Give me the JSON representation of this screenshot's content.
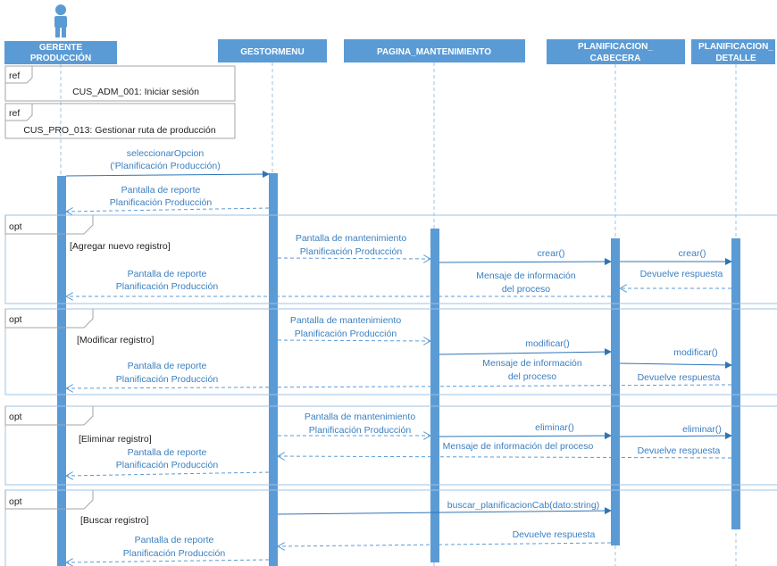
{
  "actor": {
    "icon": "user-icon",
    "label_line1": "GERENTE",
    "label_line2": "PRODUCCIÓN"
  },
  "lifelines": {
    "gestormenu": "GESTORMENU",
    "pagina": "PAGINA_MANTENIMIENTO",
    "cabecera_line1": "PLANIFICACION_",
    "cabecera_line2": "CABECERA",
    "detalle_line1": "PLANIFICACION_",
    "detalle_line2": "DETALLE"
  },
  "refs": [
    {
      "tag": "ref",
      "text": "CUS_ADM_001: Iniciar sesión"
    },
    {
      "tag": "ref",
      "text": "CUS_PRO_013: Gestionar ruta de producción"
    }
  ],
  "initial": {
    "call_line1": "seleccionarOpcion",
    "call_line2": "('Planificación Producción)",
    "return_line1": "Pantalla de reporte",
    "return_line2": "Planificación Producción"
  },
  "fragments": [
    {
      "tag": "opt",
      "guard": "[Agregar nuevo registro]",
      "mant_line1": "Pantalla de mantenimiento",
      "mant_line2": "Planificación Producción",
      "call1": "crear()",
      "call2": "crear()",
      "resp": "Devuelve respuesta",
      "info_line1": "Mensaje de información",
      "info_line2": "del proceso",
      "report_line1": "Pantalla de reporte",
      "report_line2": "Planificación Producción"
    },
    {
      "tag": "opt",
      "guard": "[Modificar registro]",
      "mant_line1": "Pantalla de mantenimiento",
      "mant_line2": "Planificación Producción",
      "call1": "modificar()",
      "call2": "modificar()",
      "resp": "Devuelve respuesta",
      "info_line1": "Mensaje de información",
      "info_line2": "del proceso",
      "report_line1": "Pantalla de reporte",
      "report_line2": "Planificación Producción"
    },
    {
      "tag": "opt",
      "guard": "[Eliminar registro]",
      "mant_line1": "Pantalla de mantenimiento",
      "mant_line2": "Planificación Producción",
      "call1": "eliminar()",
      "call2": "eliminar()",
      "resp": "Devuelve respuesta",
      "info_line1": "Mensaje de información del proceso",
      "report_line1": "Pantalla de reporte",
      "report_line2": "Planificación Producción"
    },
    {
      "tag": "opt",
      "guard": "[Buscar registro]",
      "call1": "buscar_planificacionCab(dato:string)",
      "resp": "Devuelve respuesta",
      "report_line1": "Pantalla de reporte",
      "report_line2": "Planificación Producción"
    }
  ],
  "colors": {
    "lifeline": "#5b9bd5",
    "message": "#2e75b6",
    "frame": "#9dc3e6"
  }
}
